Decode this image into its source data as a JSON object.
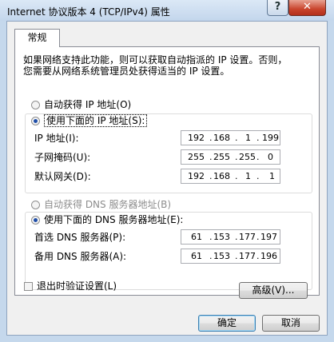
{
  "window": {
    "title": "Internet 协议版本 4 (TCP/IPv4) 属性",
    "help_label": "?",
    "close_label": "✕"
  },
  "tabs": [
    {
      "label": "常规",
      "selected": true
    }
  ],
  "description": [
    "如果网络支持此功能，则可以获取自动指派的 IP 设置。否则，",
    "您需要从网络系统管理员处获得适当的 IP 设置。"
  ],
  "ip": {
    "auto_option": "自动获得 IP 地址(O)",
    "manual_option": "使用下面的 IP 地址(S):",
    "fields": [
      {
        "label": "IP 地址(I):",
        "octets": [
          "192",
          "168",
          "1",
          "199"
        ]
      },
      {
        "label": "子网掩码(U):",
        "octets": [
          "255",
          "255",
          "255",
          "0"
        ]
      },
      {
        "label": "默认网关(D):",
        "octets": [
          "192",
          "168",
          "1",
          "1"
        ]
      }
    ]
  },
  "dns": {
    "auto_option": "自动获得 DNS 服务器地址(B)",
    "manual_option": "使用下面的 DNS 服务器地址(E):",
    "fields": [
      {
        "label": "首选 DNS 服务器(P):",
        "octets": [
          "61",
          "153",
          "177",
          "197"
        ]
      },
      {
        "label": "备用 DNS 服务器(A):",
        "octets": [
          "61",
          "153",
          "177",
          "196"
        ]
      }
    ]
  },
  "validate_on_exit": {
    "label": "退出时验证设置(L)",
    "checked": false
  },
  "buttons": {
    "advanced": "高级(V)...",
    "ok": "确定",
    "cancel": "取消"
  },
  "colors": {
    "radio_dot": "#1f4ea8",
    "close_button": "#c9452d",
    "ok_focus": "#3c7fb1"
  }
}
